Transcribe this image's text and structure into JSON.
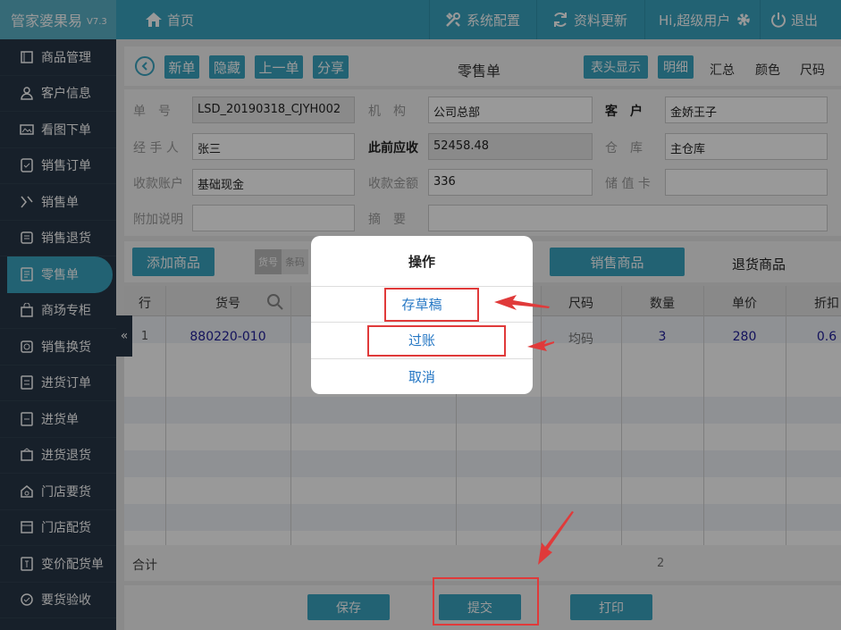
{
  "app": {
    "name": "管家婆果易",
    "version": "V7.3"
  },
  "topnav": {
    "home": "首页",
    "config": "系统配置",
    "refresh": "资料更新",
    "user": "Hi,超级用户",
    "logout": "退出"
  },
  "sidebar": {
    "items": [
      {
        "label": "商品管理",
        "icon": "goods-icon"
      },
      {
        "label": "客户信息",
        "icon": "person-icon"
      },
      {
        "label": "看图下单",
        "icon": "image-icon"
      },
      {
        "label": "销售订单",
        "icon": "order-icon"
      },
      {
        "label": "销售单",
        "icon": "sale-icon"
      },
      {
        "label": "销售退货",
        "icon": "return-icon"
      },
      {
        "label": "零售单",
        "icon": "doc-icon"
      },
      {
        "label": "商场专柜",
        "icon": "bag-icon"
      },
      {
        "label": "销售换货",
        "icon": "exchange-icon"
      },
      {
        "label": "进货订单",
        "icon": "purchase-order-icon"
      },
      {
        "label": "进货单",
        "icon": "purchase-icon"
      },
      {
        "label": "进货退货",
        "icon": "purchase-return-icon"
      },
      {
        "label": "门店要货",
        "icon": "store-request-icon"
      },
      {
        "label": "门店配货",
        "icon": "store-dist-icon"
      },
      {
        "label": "变价配货单",
        "icon": "price-change-icon"
      },
      {
        "label": "要货验收",
        "icon": "inspect-icon"
      }
    ],
    "active_index": 6
  },
  "toolbar": {
    "new": "新单",
    "hide": "隐藏",
    "prev": "上一单",
    "share": "分享",
    "title": "零售单",
    "header_show": "表头显示",
    "detail": "明细",
    "summary": "汇总",
    "color": "颜色",
    "size": "尺码"
  },
  "form": {
    "doc_no_label": "单　号",
    "doc_no": "LSD_20190318_CJYH002",
    "org_label": "机　构",
    "org": "公司总部",
    "customer_label": "客　户",
    "customer": "金娇王子",
    "handler_label": "经 手 人",
    "handler": "张三",
    "prev_recv_label": "此前应收",
    "prev_recv": "52458.48",
    "warehouse_label": "仓　库",
    "warehouse": "主仓库",
    "account_label": "收款账户",
    "account": "基础现金",
    "amount_label": "收款金额",
    "amount": "336",
    "card_label": "储 值 卡",
    "card": "",
    "note_label": "附加说明",
    "note": "",
    "summary_label": "摘　要",
    "summary": ""
  },
  "actions": {
    "add_goods": "添加商品",
    "seg_code": "货号",
    "seg_bar": "条码",
    "sale_goods": "销售商品",
    "return_goods": "退货商品"
  },
  "grid": {
    "headers": [
      "行",
      "货号",
      "尺码",
      "数量",
      "单价",
      "折扣"
    ],
    "rows": [
      {
        "line": "1",
        "code": "880220-010",
        "size": "均码",
        "qty": "3",
        "price": "280",
        "discount": "0.6"
      }
    ],
    "total_label": "合计",
    "total_qty": "2"
  },
  "bottom": {
    "save": "保存",
    "submit": "提交",
    "print": "打印"
  },
  "dialog": {
    "title": "操作",
    "draft": "存草稿",
    "post": "过账",
    "cancel": "取消"
  },
  "colors": {
    "accent": "#3aa4c0",
    "sidebar": "#273646",
    "annotation": "#e03a3a",
    "link": "#2577c4"
  }
}
